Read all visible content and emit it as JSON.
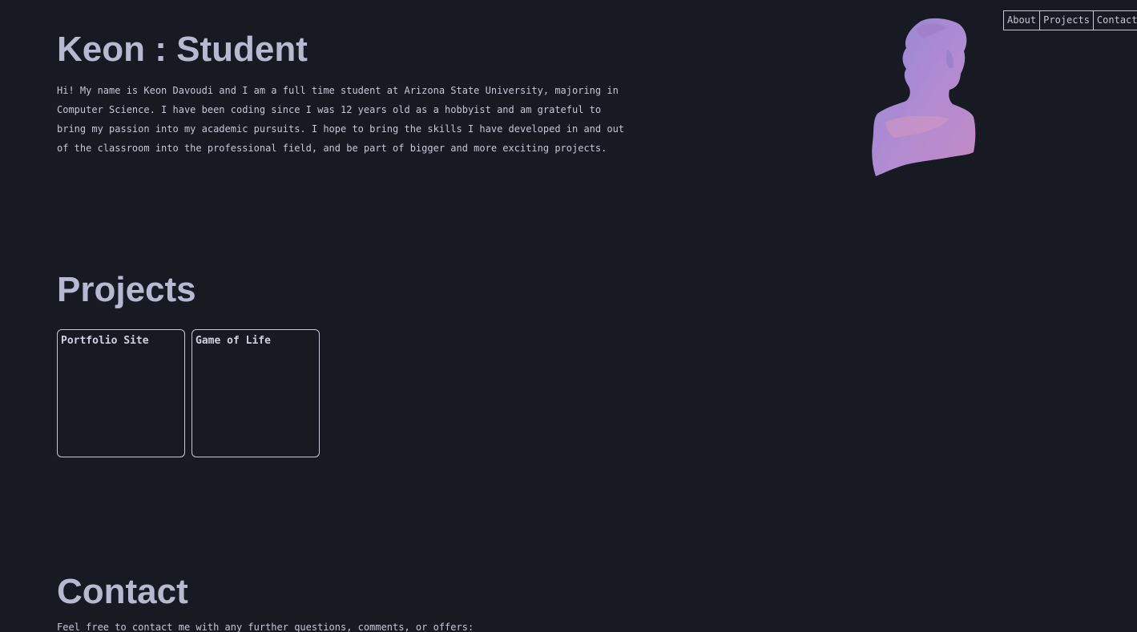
{
  "nav": {
    "items": [
      {
        "label": "About"
      },
      {
        "label": "Projects"
      },
      {
        "label": "Contact"
      }
    ]
  },
  "hero": {
    "title": "Keon : Student",
    "bio": "Hi! My name is Keon Davoudi and I am a full time student at Arizona State University, majoring in Computer Science. I have been coding since I was 12 years old as a hobbyist and am grateful to bring my passion into my academic pursuits. I hope to bring the skills I have developed in and out of the classroom into the professional field, and be part of bigger and more exciting projects.",
    "image_icon": "statue-bust-icon"
  },
  "projects": {
    "title": "Projects",
    "cards": [
      {
        "title": "Portfolio Site"
      },
      {
        "title": "Game of Life"
      }
    ]
  },
  "contact": {
    "title": "Contact",
    "text": "Feel free to contact me with any further questions, comments, or offers:"
  },
  "colors": {
    "background": "#171923",
    "text": "#c6c7d8",
    "heading": "#b7b9d0",
    "bust": "#b58ad0"
  }
}
